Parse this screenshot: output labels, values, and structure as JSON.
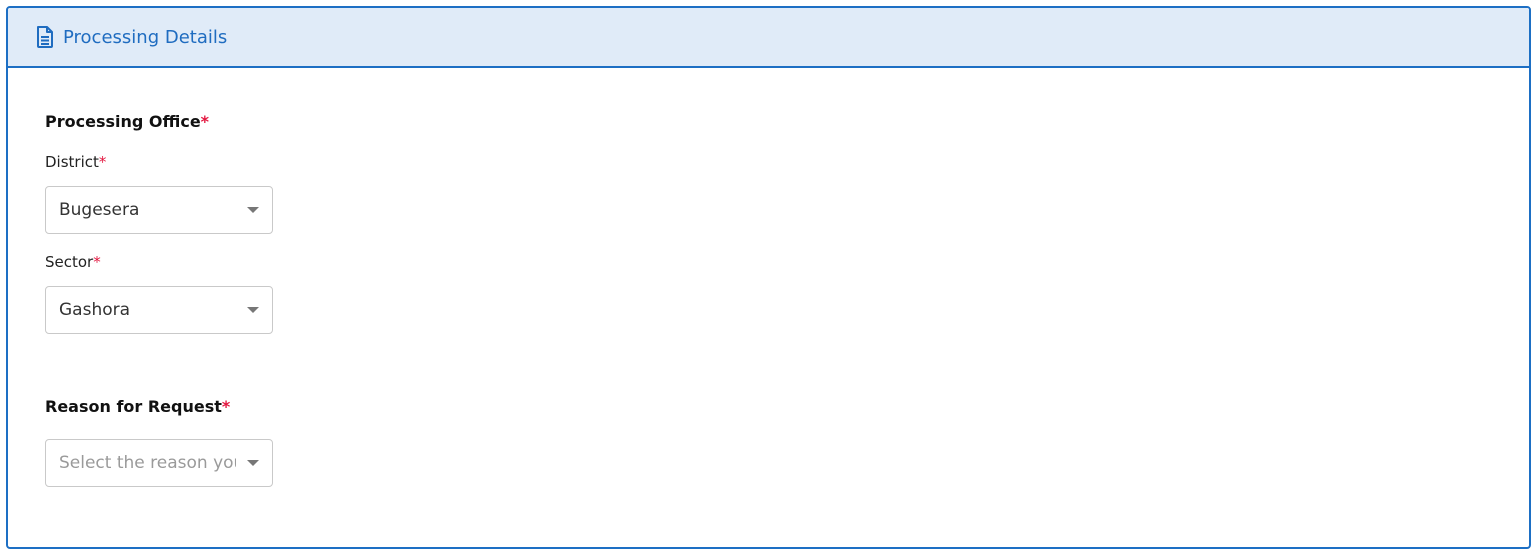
{
  "panel": {
    "title": "Processing Details",
    "icon": "document-icon",
    "accent_color": "#1d6fc4",
    "header_bg": "#e0ebf8"
  },
  "processing_office": {
    "heading": "Processing Office",
    "required_mark": "*",
    "district": {
      "label": "District",
      "required_mark": "*",
      "value": "Bugesera"
    },
    "sector": {
      "label": "Sector",
      "required_mark": "*",
      "value": "Gashora"
    }
  },
  "reason": {
    "heading": "Reason for Request",
    "required_mark": "*",
    "placeholder": "Select the reason you"
  },
  "required_color": "#e3163f"
}
